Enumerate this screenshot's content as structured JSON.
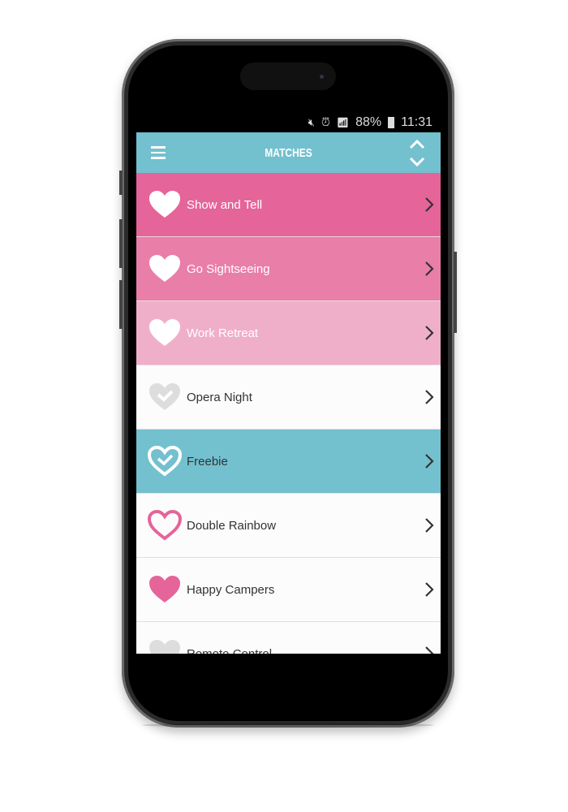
{
  "status_bar": {
    "battery": "88%",
    "time": "11:31",
    "icons": [
      "mute-icon",
      "alarm-icon",
      "wifi-icon",
      "4g-icon",
      "signal-icon",
      "battery-charging-icon"
    ]
  },
  "header": {
    "title": "MATCHES",
    "menu_icon": "hamburger-icon",
    "sort_icon": "chevron-up-down-icon",
    "color": "#73c0cf"
  },
  "matches": [
    {
      "label": "Show and Tell",
      "bg": "#e5649a",
      "icon": "heart-filled-white",
      "light": true
    },
    {
      "label": "Go Sightseeing",
      "bg": "#e97ea8",
      "icon": "heart-filled-white",
      "light": true
    },
    {
      "label": "Work Retreat",
      "bg": "#f0afc8",
      "icon": "heart-filled-white",
      "light": true
    },
    {
      "label": "Opera Night",
      "bg": "#fdfcfc",
      "icon": "heart-check-grey",
      "light": false
    },
    {
      "label": "Freebie",
      "bg": "#73c0cf",
      "icon": "heart-check-outline-white",
      "light": false
    },
    {
      "label": "Double Rainbow",
      "bg": "#fdfcfc",
      "icon": "heart-outline-pink",
      "light": false
    },
    {
      "label": "Happy Campers",
      "bg": "#fdfcfc",
      "icon": "heart-filled-pink",
      "light": false
    },
    {
      "label": "Remote Control",
      "bg": "#fdfcfc",
      "icon": "heart-filled-grey",
      "light": false
    }
  ]
}
